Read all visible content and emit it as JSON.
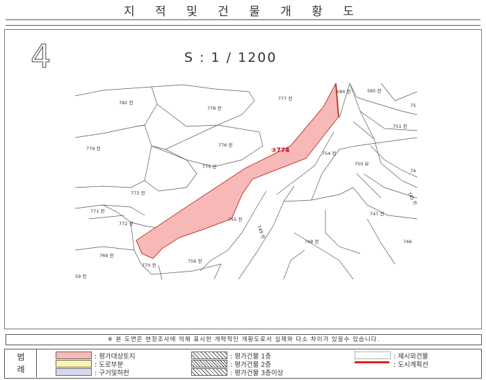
{
  "title": "지 적 및 건 물 개 황 도",
  "sheet_number": "4",
  "scale": "S : 1 / 1200",
  "parcels": [
    {
      "label": "584 전"
    },
    {
      "label": "585 전"
    },
    {
      "label": "777 전"
    },
    {
      "label": "782 전"
    },
    {
      "label": "778 전"
    },
    {
      "label": "751 전"
    },
    {
      "label": "779 전"
    },
    {
      "label": "776 전"
    },
    {
      "label": "754 전"
    },
    {
      "label": "750 묘"
    },
    {
      "label": "775 전"
    },
    {
      "label": "773 전"
    },
    {
      "label": "771 전"
    },
    {
      "label": "772 전"
    },
    {
      "label": "755 전"
    },
    {
      "label": "747 전"
    },
    {
      "label": "748 전"
    },
    {
      "label": "769 전"
    },
    {
      "label": "770 전"
    },
    {
      "label": "756 전"
    },
    {
      "label": "746"
    },
    {
      "label": "749 전"
    },
    {
      "label": "745 전"
    },
    {
      "label": "74"
    },
    {
      "label": "75"
    },
    {
      "label": "59 전"
    }
  ],
  "subject_label": "③774",
  "note": "※ 본 도면은 현장조사에 의해 표시한 개략적인 개황도로서 실제와 다소 차이가 있을수 있습니다.",
  "legend": {
    "heading_1": "범",
    "heading_2": "례",
    "items": [
      {
        "label": ": 평가대상토지",
        "color": "#f7b8b8"
      },
      {
        "label": ": 도로부분",
        "color": "#fbf3b0"
      },
      {
        "label": ": 구거및하천",
        "color": "#d6d8f2"
      },
      {
        "label": ": 평가건물 1층"
      },
      {
        "label": ": 평가건물 2층"
      },
      {
        "label": ": 평가건물 3층이상"
      },
      {
        "label": ": 제시외건물"
      },
      {
        "label": ": 도시계획선",
        "color": "#e02020"
      }
    ]
  }
}
